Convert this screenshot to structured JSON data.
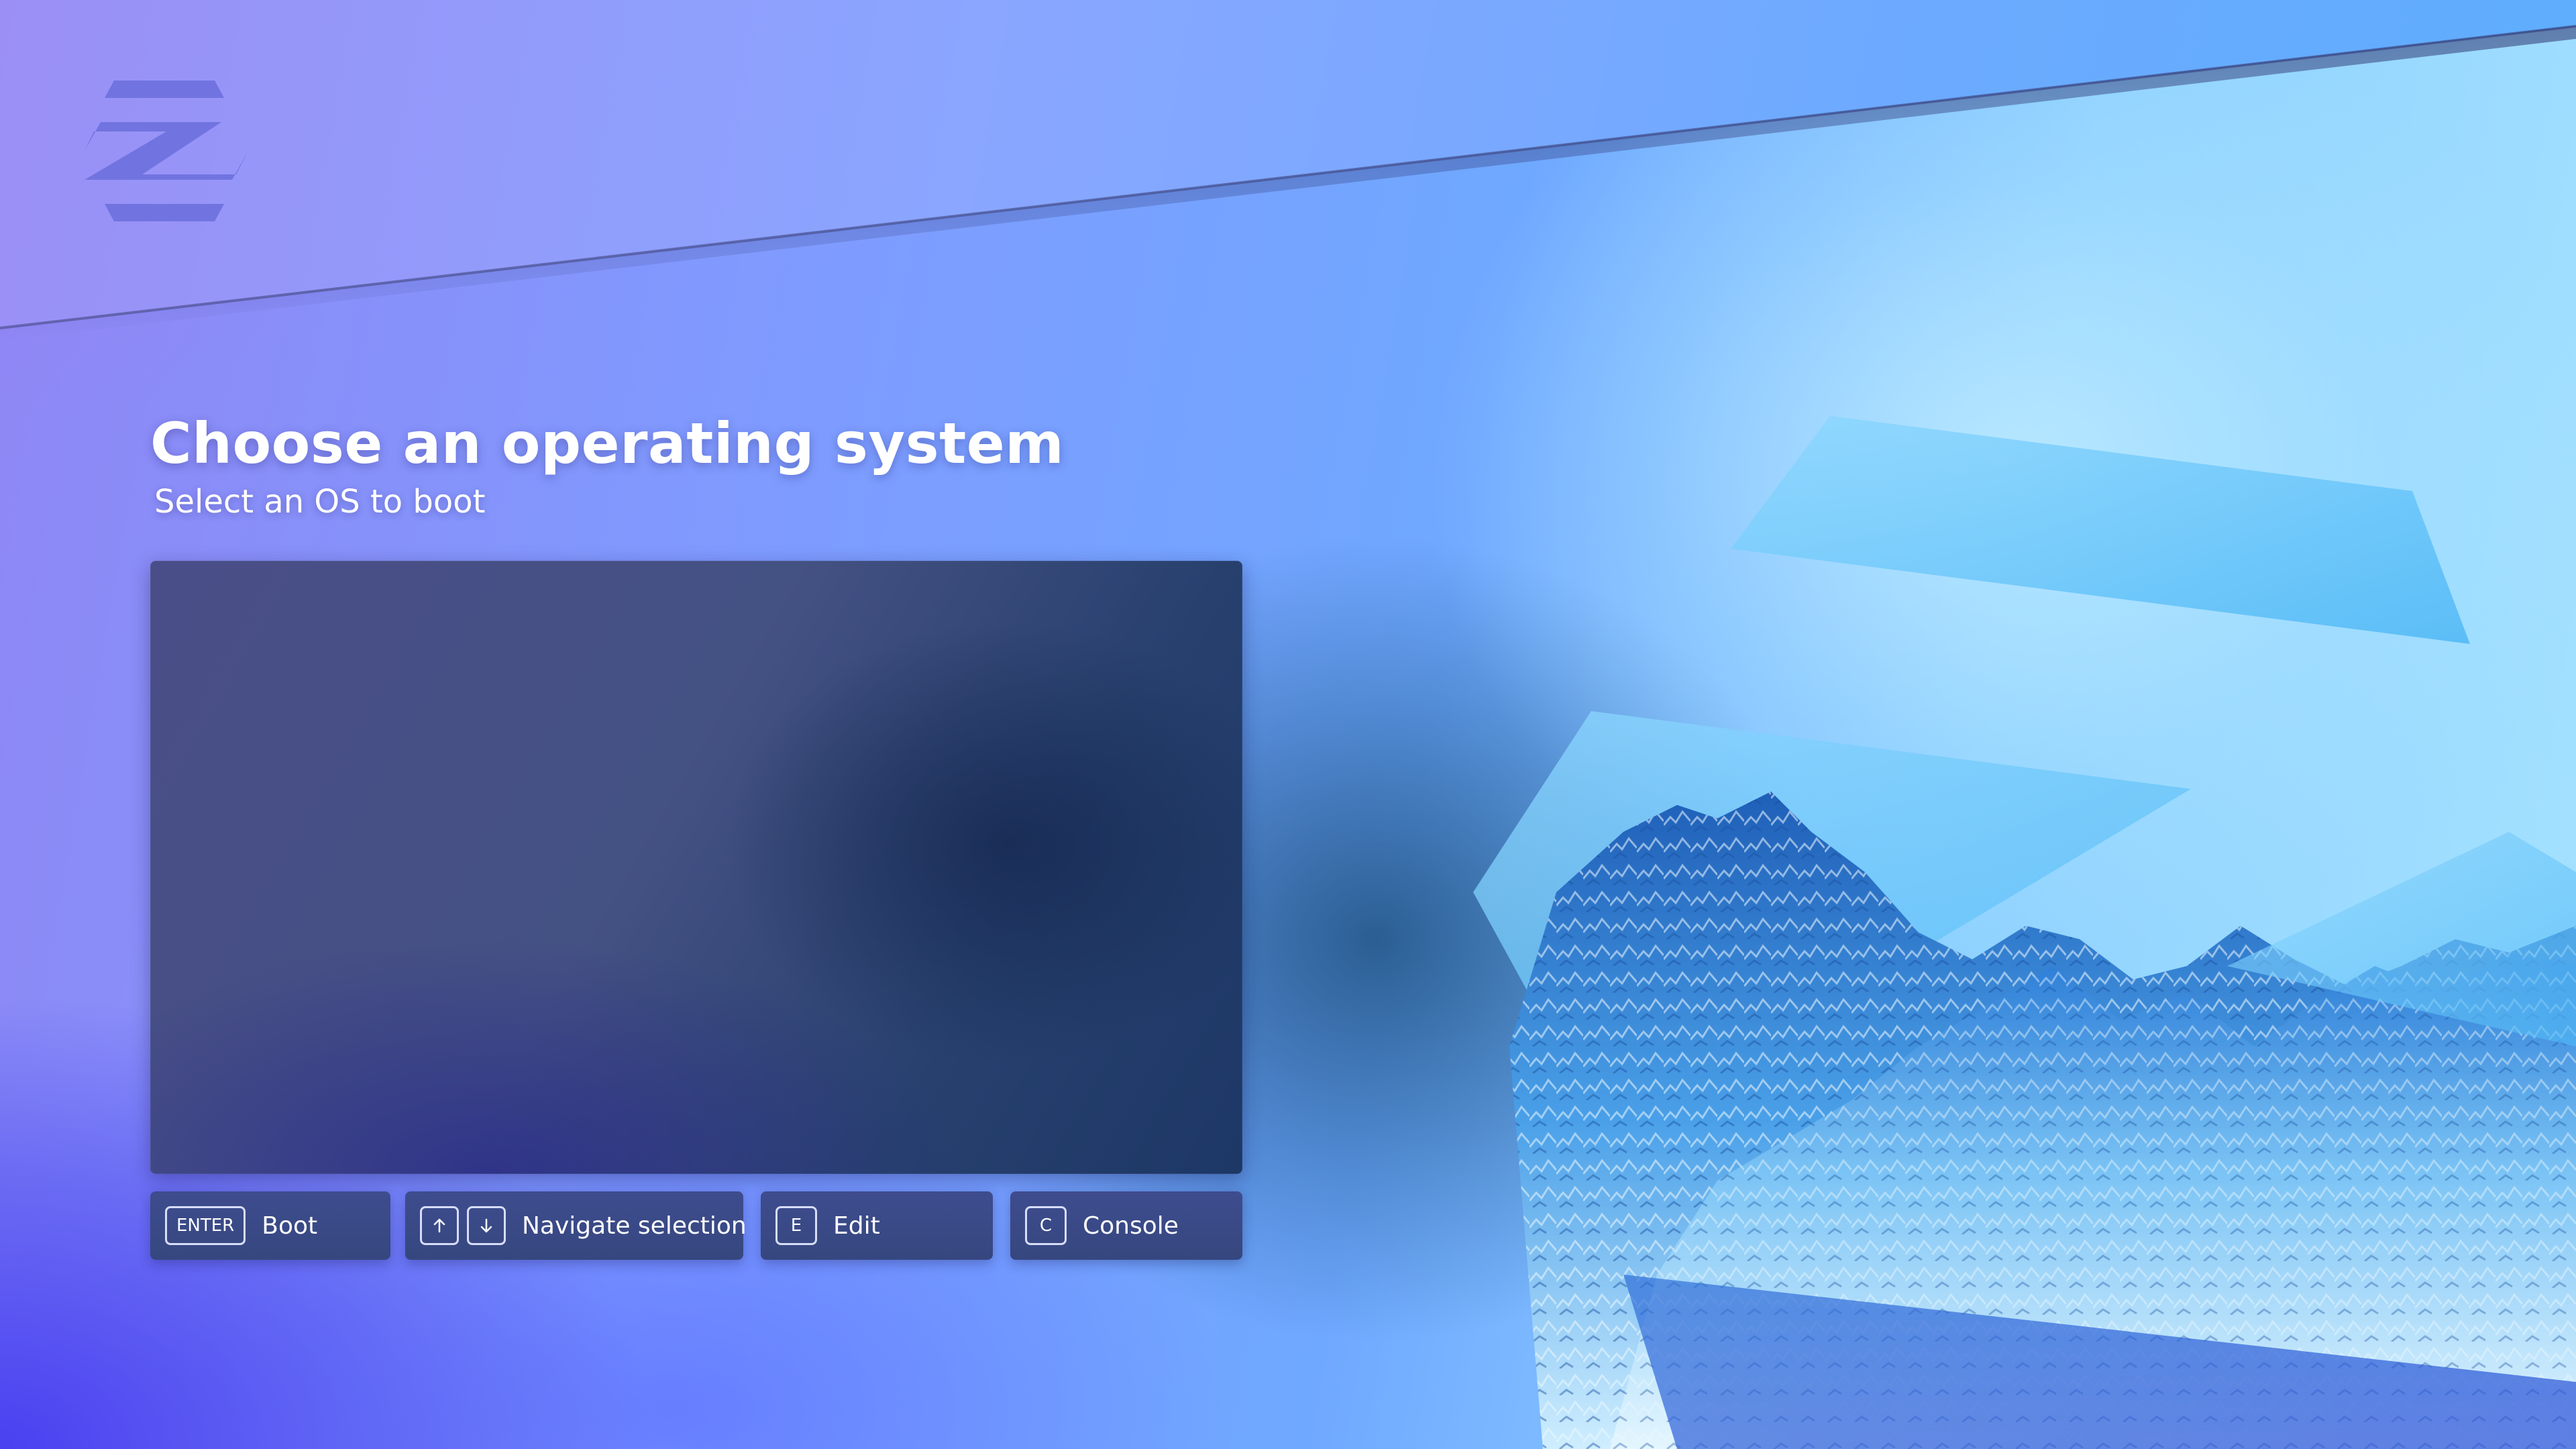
{
  "screen": {
    "title": "Choose an operating system",
    "subtitle": "Select an OS to boot"
  },
  "os_list": {
    "entries": []
  },
  "hints": {
    "boot": {
      "key": "ENTER",
      "label": "Boot"
    },
    "navigate": {
      "keys": [
        "up-arrow-icon",
        "down-arrow-icon"
      ],
      "label": "Navigate selection"
    },
    "edit": {
      "key": "E",
      "label": "Edit"
    },
    "console": {
      "key": "C",
      "label": "Console"
    }
  },
  "logo": {
    "icon": "zorin-logo-icon"
  },
  "colors": {
    "panel": "#445183",
    "hint_bg": "#3a4a87",
    "text": "#ffffff",
    "key_border": "#d7ddf7"
  }
}
